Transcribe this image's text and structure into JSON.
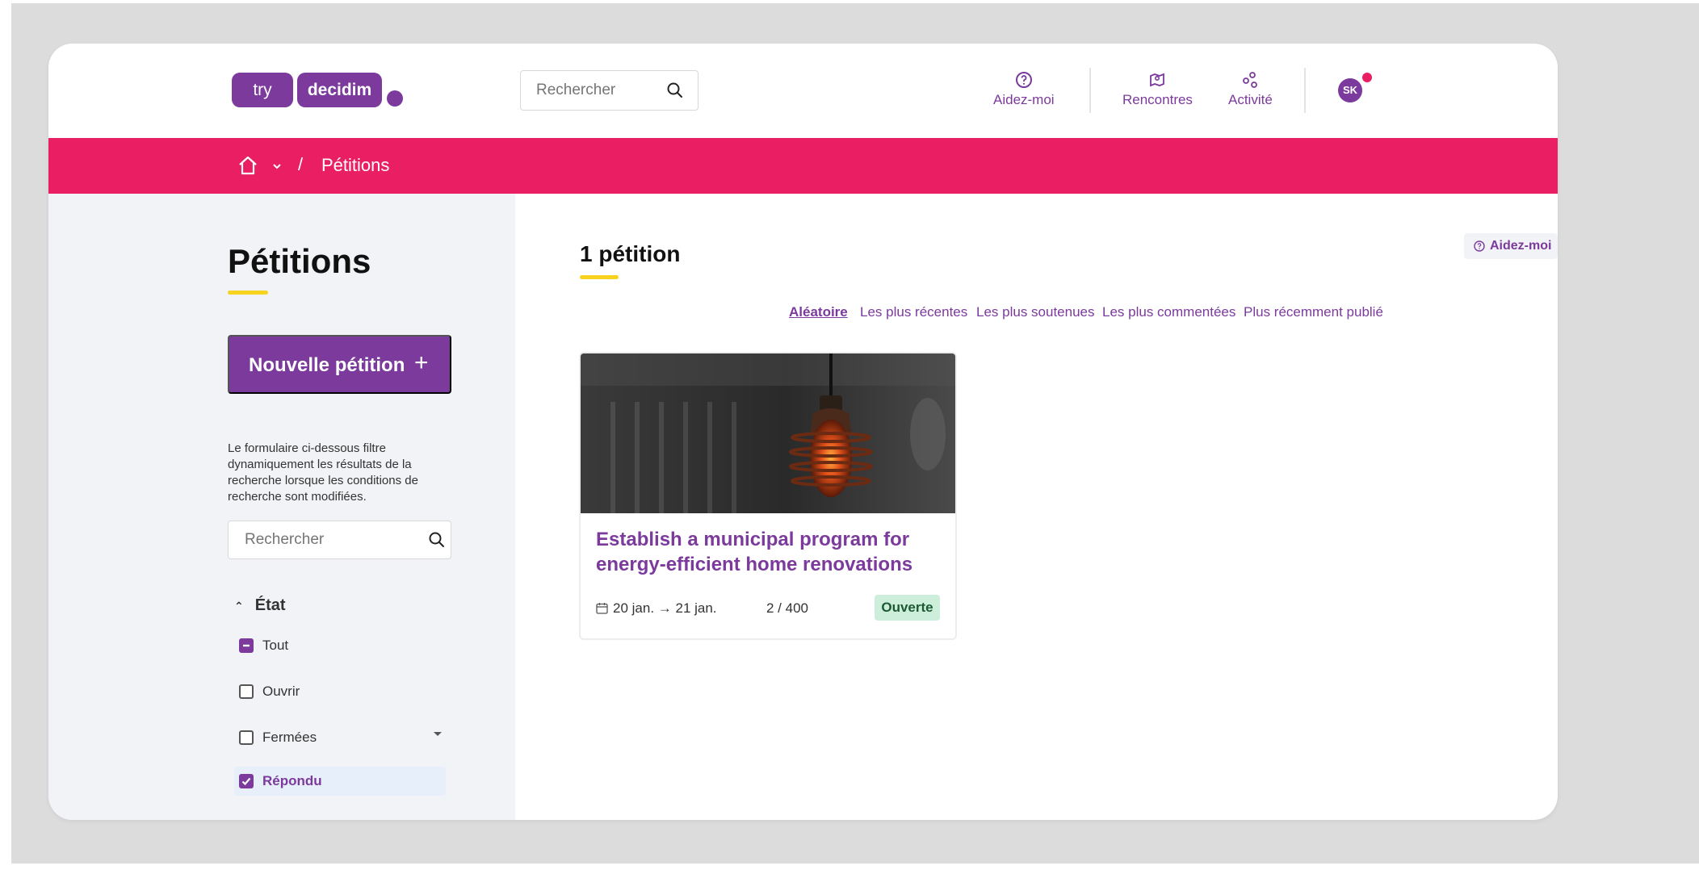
{
  "header": {
    "logo_try": "try",
    "logo_decidim": "decidim",
    "search_placeholder": "Rechercher",
    "nav": {
      "help": "Aidez-moi",
      "meetings": "Rencontres",
      "activity": "Activité"
    },
    "avatar_initials": "SK"
  },
  "breadcrumb": {
    "separator": "/",
    "current": "Pétitions"
  },
  "sidebar": {
    "title": "Pétitions",
    "new_button": "Nouvelle pétition",
    "new_button_icon": "+",
    "filter_help": "Le formulaire ci-dessous filtre dynamiquement les résultats de la recherche lorsque les conditions de recherche sont modifiées.",
    "search_placeholder": "Rechercher",
    "state_filter": {
      "heading": "État",
      "options": [
        {
          "label": "Tout",
          "state": "indeterminate"
        },
        {
          "label": "Ouvrir",
          "state": "unchecked"
        },
        {
          "label": "Fermées",
          "state": "unchecked"
        },
        {
          "label": "Répondu",
          "state": "checked"
        }
      ]
    }
  },
  "main": {
    "count_title": "1 pétition",
    "help_chip": "Aidez-moi",
    "sort_options": [
      {
        "label": "Aléatoire",
        "active": true
      },
      {
        "label": "Les plus récentes",
        "active": false
      },
      {
        "label": "Les plus soutenues",
        "active": false
      },
      {
        "label": "Les plus commentées",
        "active": false
      },
      {
        "label": "Plus récemment publié",
        "active": false
      }
    ],
    "cards": [
      {
        "title": "Establish a municipal program for energy-efficient home renovations",
        "dates": "20 jan. → 21 jan.",
        "votes": "2 / 400",
        "status": "Ouverte"
      }
    ]
  },
  "colors": {
    "brand_purple": "#7b3a9c",
    "breadcrumb_pink": "#e91e63",
    "underline_yellow": "#f7d21e",
    "status_open_bg": "#cdeedb"
  }
}
